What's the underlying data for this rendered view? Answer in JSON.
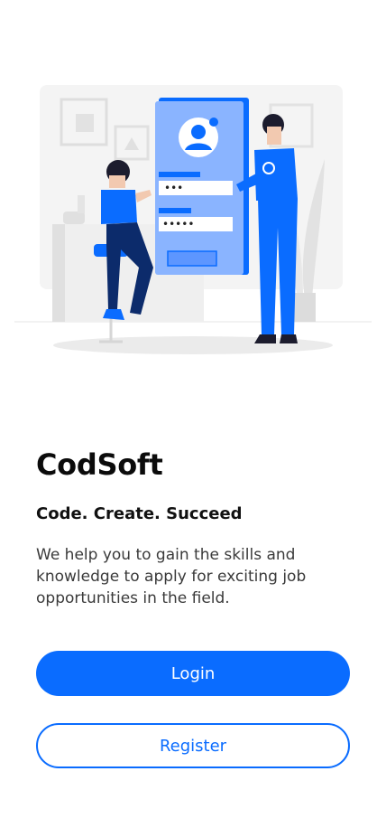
{
  "illustration": {
    "icon": "login-illustration",
    "masked_password_short": "•••",
    "masked_password_long": "•••••"
  },
  "brand": {
    "title": "CodSoft",
    "tagline": "Code. Create. Succeed",
    "description": "We help you to gain the skills and knowledge to apply for exciting job opportunities in the field."
  },
  "actions": {
    "login_label": "Login",
    "register_label": "Register"
  },
  "colors": {
    "accent": "#0a6cff",
    "text": "#111111",
    "muted": "#3a3a3a"
  }
}
